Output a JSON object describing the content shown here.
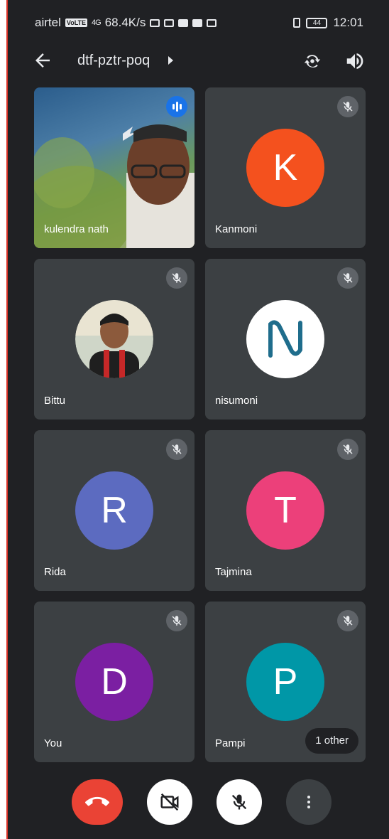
{
  "status_bar": {
    "carrier": "airtel",
    "volte": "VoLTE",
    "network": "4G",
    "speed": "68.4K/s",
    "battery": "44",
    "time": "12:01"
  },
  "header": {
    "meeting_code": "dtf-pztr-poq"
  },
  "participants": [
    {
      "name": "kulendra nath",
      "type": "video",
      "speaking": true
    },
    {
      "name": "Kanmoni",
      "initial": "K",
      "color": "#f4511e",
      "muted": true
    },
    {
      "name": "Bittu",
      "type": "photo",
      "muted": true
    },
    {
      "name": "nisumoni",
      "initial": "N",
      "color": "#ffffff",
      "muted": true
    },
    {
      "name": "Rida",
      "initial": "R",
      "color": "#5c6bc0",
      "muted": true
    },
    {
      "name": "Tajmina",
      "initial": "T",
      "color": "#ec407a",
      "muted": true
    },
    {
      "name": "You",
      "initial": "D",
      "color": "#7b1fa2",
      "muted": true
    },
    {
      "name": "Pampi",
      "initial": "P",
      "color": "#0097a7",
      "muted": true
    }
  ],
  "others_chip": "1 other",
  "controls": {
    "end_call_color": "#ea4335"
  }
}
